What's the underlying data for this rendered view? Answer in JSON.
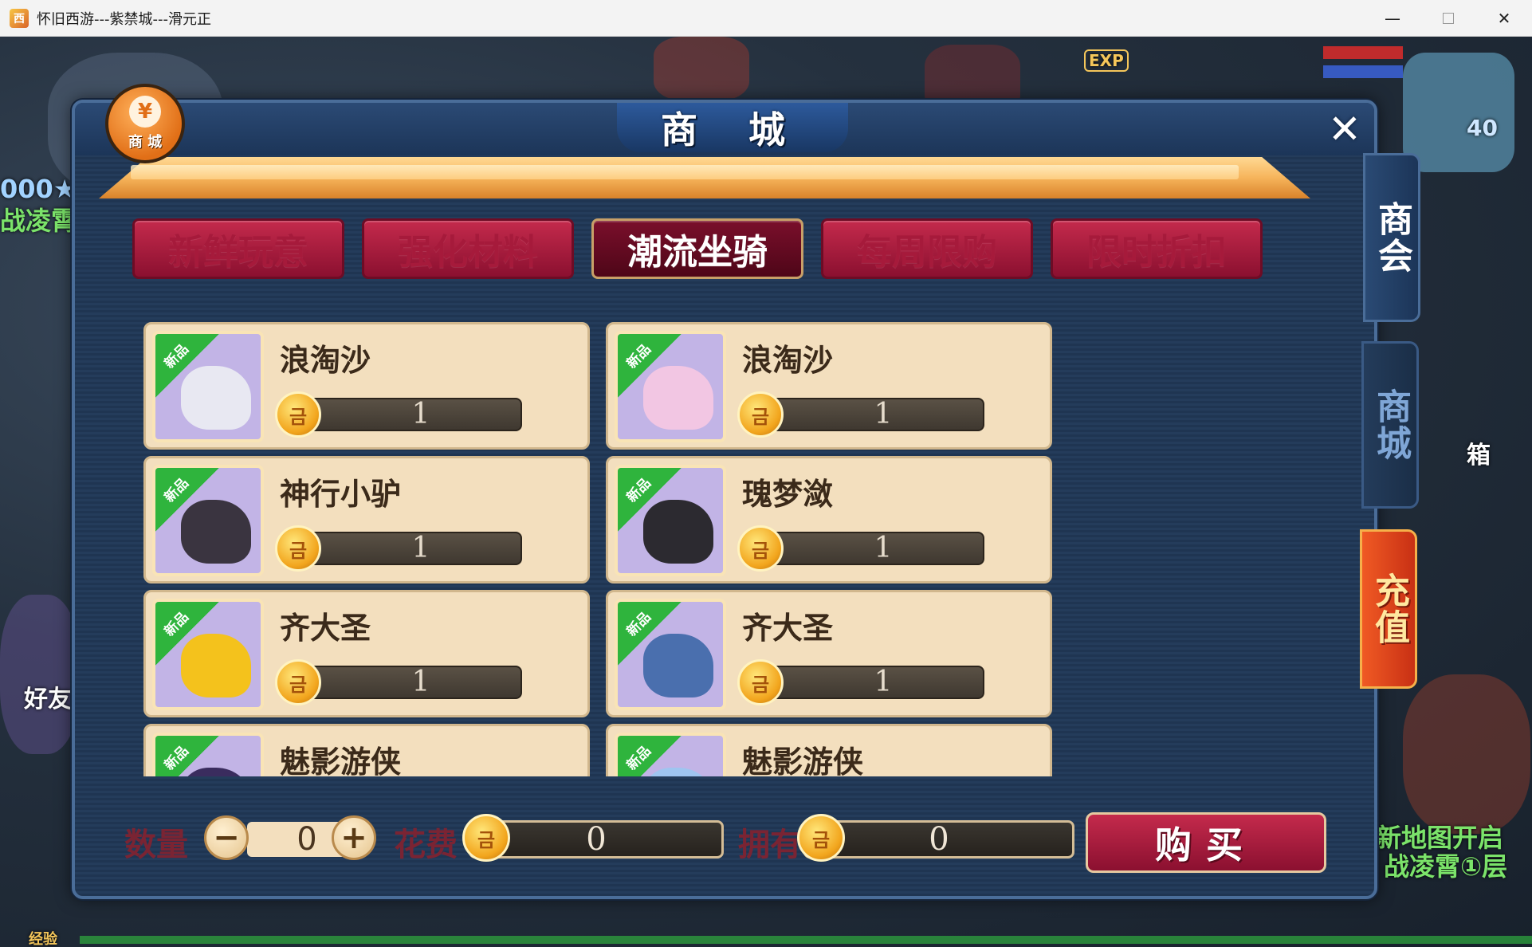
{
  "window": {
    "title": "怀旧西游---紫禁城---滑元正",
    "minimize": "—",
    "close": "✕"
  },
  "background": {
    "exp_badge": "EXP",
    "left_text_1": "000★",
    "left_text_2": "战凌霄",
    "left_text_3": "好友",
    "right_text_1": "箱",
    "right_text_2": "新地图开启",
    "right_text_3": "战凌霄①层",
    "level_frag": "40",
    "bottom_left": "经验"
  },
  "dialog": {
    "title": "商 城",
    "close": "✕",
    "badge_label": "商 城",
    "badge_symbol": "¥"
  },
  "tabs": [
    {
      "label": "新鲜玩意",
      "active": false
    },
    {
      "label": "强化材料",
      "active": false
    },
    {
      "label": "潮流坐骑",
      "active": true
    },
    {
      "label": "每周限购",
      "active": false
    },
    {
      "label": "限时折扣",
      "active": false
    }
  ],
  "items": [
    {
      "name": "浪淘沙",
      "price": "1",
      "tag": "新品",
      "color": "#e8e8f2"
    },
    {
      "name": "浪淘沙",
      "price": "1",
      "tag": "新品",
      "color": "#f2c6e3"
    },
    {
      "name": "神行小驴",
      "price": "1",
      "tag": "新品",
      "color": "#3a3440"
    },
    {
      "name": "瑰梦潋",
      "price": "1",
      "tag": "新品",
      "color": "#2c2a30"
    },
    {
      "name": "齐大圣",
      "price": "1",
      "tag": "新品",
      "color": "#f4c21c"
    },
    {
      "name": "齐大圣",
      "price": "1",
      "tag": "新品",
      "color": "#4a6fae"
    },
    {
      "name": "魅影游侠",
      "price": "",
      "tag": "新品",
      "color": "#3a2c5e"
    },
    {
      "name": "魅影游侠",
      "price": "",
      "tag": "新品",
      "color": "#9fc5f0"
    }
  ],
  "coin_glyph": "금",
  "bottom": {
    "qty_label": "数量",
    "minus": "−",
    "qty_value": "0",
    "plus": "+",
    "cost_label": "花费",
    "cost_value": "0",
    "own_label": "拥有",
    "own_value": "0",
    "buy_label": "购买"
  },
  "side_tabs": {
    "shanghui": "商会",
    "shangcheng": "商城",
    "chongzhi": "充值"
  }
}
